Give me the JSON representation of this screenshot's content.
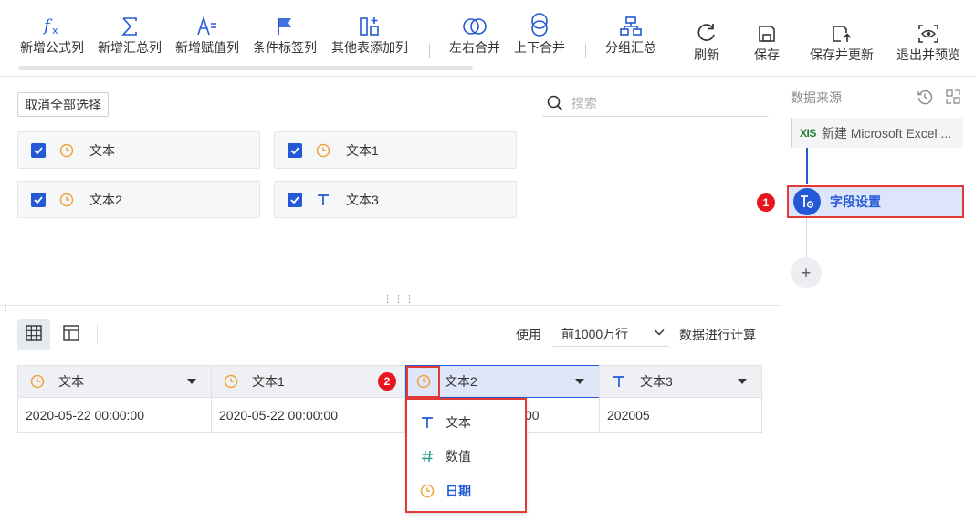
{
  "toolbar": {
    "items": [
      {
        "label": "新增公式列",
        "icon": "formula-icon"
      },
      {
        "label": "新增汇总列",
        "icon": "sigma-icon"
      },
      {
        "label": "新增赋值列",
        "icon": "assign-icon"
      },
      {
        "label": "条件标签列",
        "icon": "flag-icon"
      },
      {
        "label": "其他表添加列",
        "icon": "add-column-icon"
      },
      {
        "label": "左右合并",
        "icon": "horizontal-merge-icon"
      },
      {
        "label": "上下合并",
        "icon": "vertical-merge-icon"
      },
      {
        "label": "分组汇总",
        "icon": "group-summary-icon"
      },
      {
        "label": "刷新",
        "icon": "refresh-icon"
      },
      {
        "label": "保存",
        "icon": "save-icon"
      },
      {
        "label": "保存并更新",
        "icon": "save-update-icon"
      },
      {
        "label": "退出并预览",
        "icon": "exit-preview-icon"
      }
    ]
  },
  "field_select": {
    "deselect_all": "取消全部选择",
    "search_placeholder": "搜索",
    "fields": [
      {
        "label": "文本",
        "checked": true,
        "type_icon": "clock-icon"
      },
      {
        "label": "文本1",
        "checked": true,
        "type_icon": "clock-icon"
      },
      {
        "label": "文本2",
        "checked": true,
        "type_icon": "clock-icon"
      },
      {
        "label": "文本3",
        "checked": true,
        "type_icon": "text-type-icon"
      }
    ]
  },
  "preview": {
    "use_label": "使用",
    "rows_option": "前1000万行",
    "calc_label": "数据进行计算",
    "columns": [
      {
        "label": "文本",
        "type_icon": "clock-icon"
      },
      {
        "label": "文本1",
        "type_icon": "clock-icon"
      },
      {
        "label": "文本2",
        "type_icon": "clock-icon"
      },
      {
        "label": "文本3",
        "type_icon": "text-type-icon"
      }
    ],
    "rows": [
      [
        "2020-05-22 00:00:00",
        "2020-05-22 00:00:00",
        "00",
        "202005"
      ]
    ]
  },
  "type_dropdown": {
    "items": [
      {
        "label": "文本",
        "icon": "text-type-icon"
      },
      {
        "label": "数值",
        "icon": "number-type-icon"
      },
      {
        "label": "日期",
        "icon": "clock-icon",
        "active": true
      }
    ]
  },
  "annotations": {
    "badge1": "1",
    "badge2": "2"
  },
  "sidebar": {
    "title": "数据来源",
    "datasource_label": "新建 Microsoft Excel ...",
    "datasource_icon_text": "XIS",
    "field_setting_label": "字段设置",
    "add_label": "+"
  },
  "colors": {
    "accent": "#2458d6",
    "date_icon": "#f0a23c",
    "number_icon": "#2a9d8f",
    "highlight": "#e53935"
  }
}
